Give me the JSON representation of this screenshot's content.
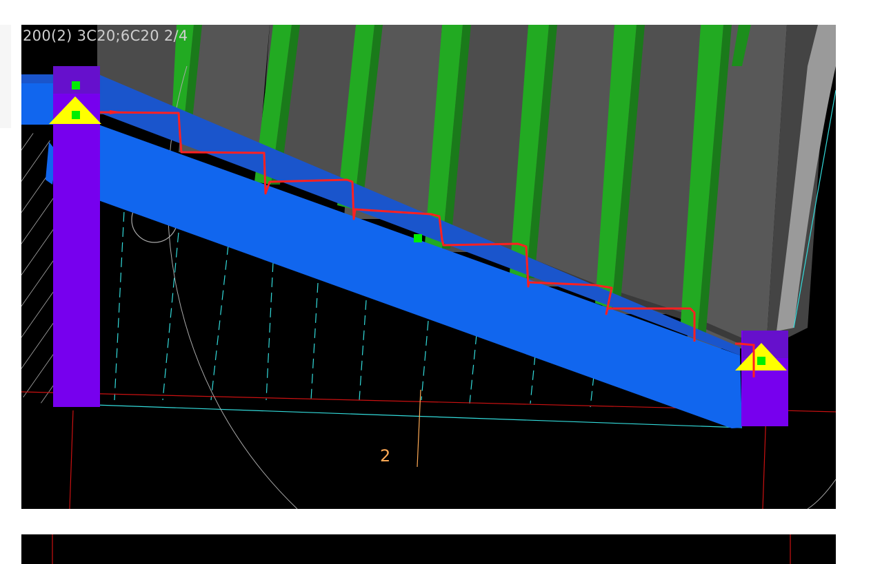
{
  "viewport": {
    "rebar_label": "200(2) 3C20;6C20 2/4",
    "axis_label": "2"
  },
  "colors": {
    "background": "#000000",
    "beam": "#1166ee",
    "column": "#7700ee",
    "support_marker": "#ffff00",
    "node_marker": "#00ee00",
    "stair_step": "#4a4a4a",
    "stirrup": "#22aa22",
    "rebar_sketch": "#ff2020",
    "grid_line": "#33dddd",
    "axis_line": "#ffaa55",
    "label_text": "#cfcfcf"
  },
  "icons": [
    "support-triangle-icon",
    "node-square-icon"
  ]
}
